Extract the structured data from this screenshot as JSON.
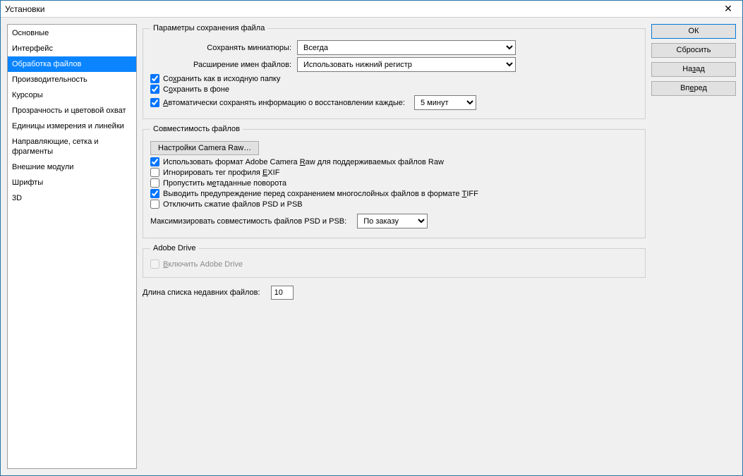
{
  "window": {
    "title": "Установки"
  },
  "sidebar": {
    "items": [
      "Основные",
      "Интерфейс",
      "Обработка файлов",
      "Производительность",
      "Курсоры",
      "Прозрачность и цветовой охват",
      "Единицы измерения и линейки",
      "Направляющие, сетка и фрагменты",
      "Внешние модули",
      "Шрифты",
      "3D"
    ],
    "selected_index": 2
  },
  "actions": {
    "ok": "ОК",
    "reset": "Сбросить",
    "back_prefix": "На",
    "back_u": "з",
    "back_suffix": "ад",
    "forward": "Вп",
    "forward_u": "е",
    "forward_suffix": "ред"
  },
  "group_save": {
    "legend": "Параметры сохранения файла",
    "thumb_label": "Сохранять миниатюры:",
    "thumb_value": "Всегда",
    "ext_label": "Расширение имен файлов:",
    "ext_value": "Использовать нижний регистр",
    "save_source_pre": "Со",
    "save_source_u": "х",
    "save_source_post": "ранить как в исходную папку",
    "save_bg_pre": "С",
    "save_bg_u": "о",
    "save_bg_post": "хранить в фоне",
    "autosave_u": "А",
    "autosave_post": "втоматически сохранять информацию о восстановлении каждые:",
    "autosave_value": "5 минут",
    "save_source_checked": true,
    "save_bg_checked": true,
    "autosave_checked": true
  },
  "group_compat": {
    "legend": "Совместимость файлов",
    "camera_raw_btn": "Настройки Camera Raw…",
    "use_acr_pre": "Использовать формат Adobe Camera ",
    "use_acr_u": "R",
    "use_acr_post": "aw для поддерживаемых файлов Raw",
    "use_acr_checked": true,
    "ignore_exif_pre": "Игнорировать тег профиля ",
    "ignore_exif_u": "E",
    "ignore_exif_post": "XIF",
    "ignore_exif_checked": false,
    "skip_meta_pre": "Пропустить м",
    "skip_meta_u": "е",
    "skip_meta_post": "таданные поворота",
    "skip_meta_checked": false,
    "tiff_warn_pre": "Выводить предупреждение перед сохранением многослойных файлов в формате ",
    "tiff_warn_u": "T",
    "tiff_warn_post": "IFF",
    "tiff_warn_checked": true,
    "disable_comp": "Отключить сжатие файлов PSD и PSB",
    "disable_comp_checked": false,
    "max_compat_label": "Максимизировать совместимость файлов PSD и PSB:",
    "max_compat_value": "По заказу"
  },
  "group_drive": {
    "legend": "Adobe Drive",
    "enable_u": "В",
    "enable_post": "ключить Adobe Drive",
    "enable_checked": false,
    "enable_disabled": true
  },
  "recent": {
    "label": "Длина списка недавних файлов:",
    "value": "10"
  }
}
